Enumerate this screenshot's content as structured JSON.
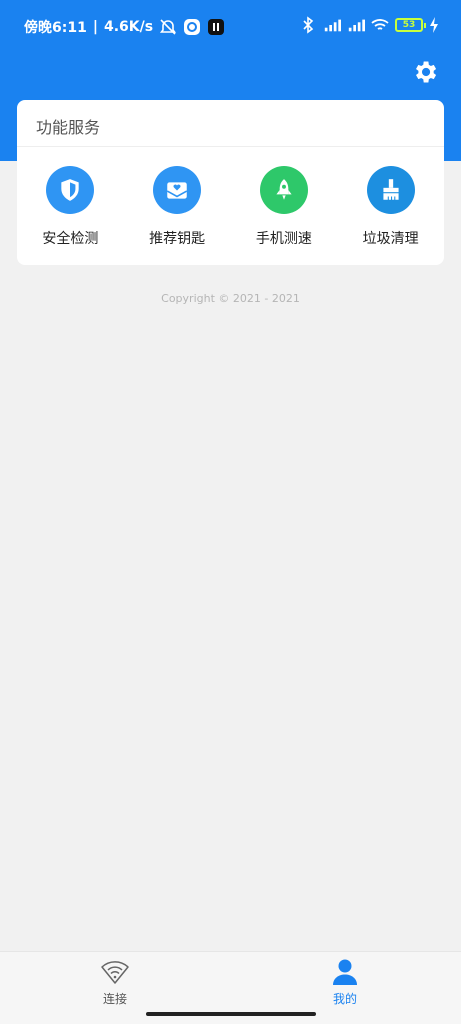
{
  "status_bar": {
    "time": "傍晚6:11",
    "speed": "4.6K/s",
    "battery": "53"
  },
  "card": {
    "title": "功能服务",
    "services": [
      {
        "label": "安全检测",
        "icon": "shield-icon",
        "color": "#2f95f3"
      },
      {
        "label": "推荐钥匙",
        "icon": "key-mail-icon",
        "color": "#2f95f3"
      },
      {
        "label": "手机测速",
        "icon": "rocket-icon",
        "color": "#2ec86a"
      },
      {
        "label": "垃圾清理",
        "icon": "broom-icon",
        "color": "#1d8fe0"
      }
    ]
  },
  "copyright": "Copyright © 2021 - 2021",
  "tabs": [
    {
      "label": "连接",
      "icon": "wifi-icon",
      "active": false
    },
    {
      "label": "我的",
      "icon": "person-icon",
      "active": true
    }
  ],
  "colors": {
    "primary": "#1a82f0",
    "active_tab": "#1a82f0",
    "inactive_tab": "#555555"
  }
}
